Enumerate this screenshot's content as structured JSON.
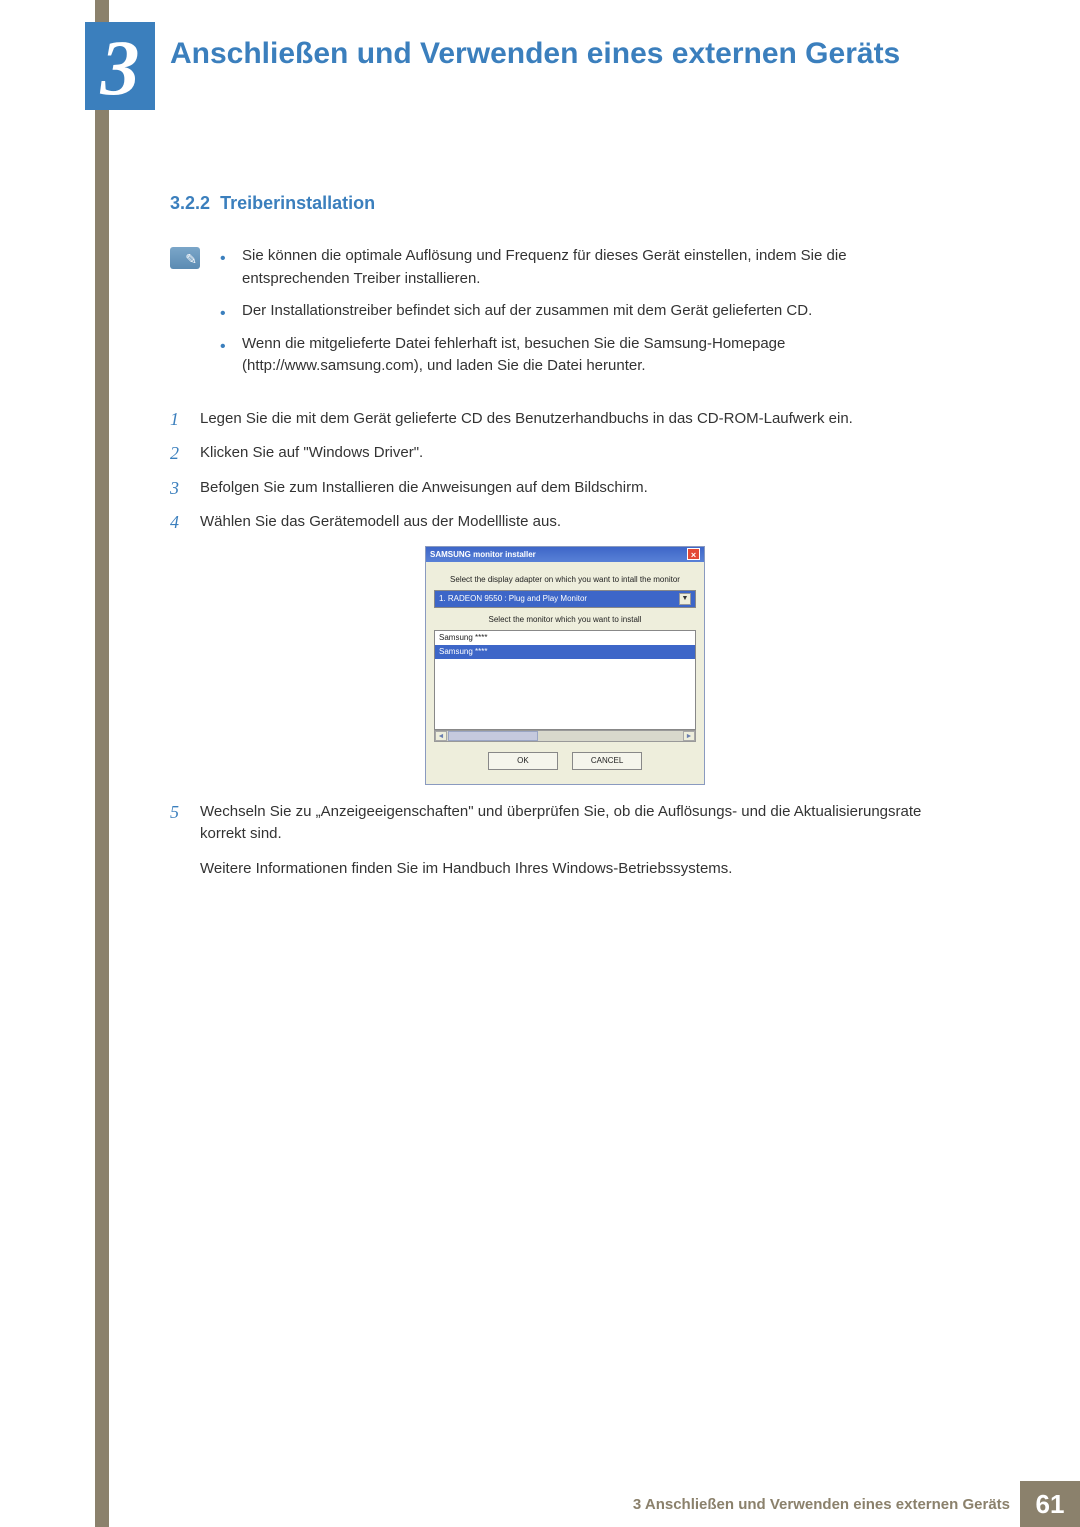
{
  "chapter": {
    "number": "3",
    "title": "Anschließen und Verwenden eines externen Geräts"
  },
  "section": {
    "number": "3.2.2",
    "title": "Treiberinstallation"
  },
  "notes": [
    "Sie können die optimale Auflösung und Frequenz für dieses Gerät einstellen, indem Sie die entsprechenden Treiber installieren.",
    "Der Installationstreiber befindet sich auf der zusammen mit dem Gerät gelieferten CD.",
    "Wenn die mitgelieferte Datei fehlerhaft ist, besuchen Sie die Samsung-Homepage (http://www.samsung.com), und laden Sie die Datei herunter."
  ],
  "steps": [
    {
      "n": "1",
      "text": "Legen Sie die mit dem Gerät gelieferte CD des Benutzerhandbuchs in das CD-ROM-Laufwerk ein."
    },
    {
      "n": "2",
      "text": "Klicken Sie auf \"Windows Driver\"."
    },
    {
      "n": "3",
      "text": "Befolgen Sie zum Installieren die Anweisungen auf dem Bildschirm."
    },
    {
      "n": "4",
      "text": "Wählen Sie das Gerätemodell aus der Modellliste aus."
    },
    {
      "n": "5",
      "text": "Wechseln Sie zu „Anzeigeeigenschaften\" und überprüfen Sie, ob die Auflösungs- und die Aktualisierungsrate korrekt sind."
    }
  ],
  "step5_extra": "Weitere Informationen finden Sie im Handbuch Ihres Windows-Betriebssystems.",
  "dialog": {
    "title": "SAMSUNG monitor installer",
    "label_adapter": "Select the display adapter on which you want to intall the monitor",
    "adapter_value": "1. RADEON 9550 : Plug and Play Monitor",
    "label_monitor": "Select the monitor which you want to install",
    "list": [
      "Samsung ****",
      "Samsung ****"
    ],
    "ok": "OK",
    "cancel": "CANCEL"
  },
  "footer": {
    "text": "3 Anschließen und Verwenden eines externen Geräts",
    "page": "61"
  }
}
